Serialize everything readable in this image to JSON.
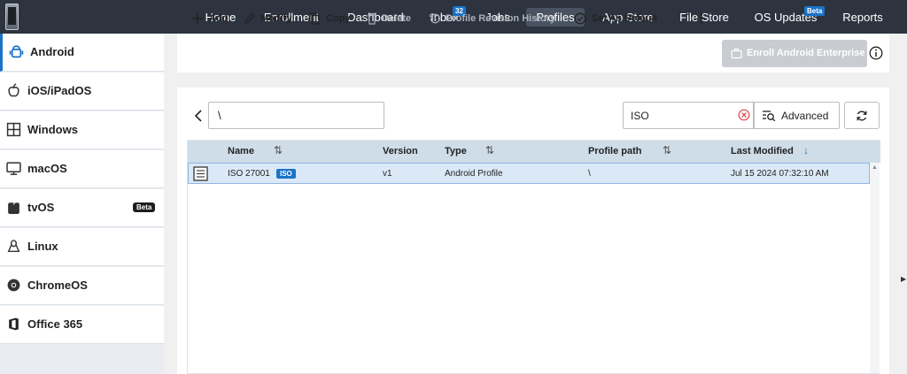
{
  "nav": {
    "items": [
      {
        "label": "Home"
      },
      {
        "label": "Enrollment"
      },
      {
        "label": "Dashboard"
      },
      {
        "label": "Inbox",
        "badge": "32"
      },
      {
        "label": "Jobs"
      },
      {
        "label": "Profiles",
        "active": true
      },
      {
        "label": "App Store"
      },
      {
        "label": "File Store"
      },
      {
        "label": "OS Updates",
        "badge": "Beta"
      },
      {
        "label": "Reports"
      }
    ]
  },
  "sidebar": {
    "items": [
      {
        "label": "Android",
        "icon": "android-icon",
        "active": true
      },
      {
        "label": "iOS/iPadOS",
        "icon": "apple-icon"
      },
      {
        "label": "Windows",
        "icon": "windows-icon"
      },
      {
        "label": "macOS",
        "icon": "monitor-icon"
      },
      {
        "label": "tvOS",
        "icon": "tv-icon",
        "badge": "Beta"
      },
      {
        "label": "Linux",
        "icon": "linux-icon"
      },
      {
        "label": "ChromeOS",
        "icon": "chrome-icon"
      },
      {
        "label": "Office 365",
        "icon": "office-icon"
      }
    ]
  },
  "toolbar": {
    "add": "Add",
    "modify": "Modify",
    "copy": "Copy",
    "delete": "Delete",
    "history": "Profile Revision History",
    "set_default": "Set As Default",
    "enroll": "Enroll Android Enterprise"
  },
  "filters": {
    "path_value": "\\",
    "search_value": "ISO",
    "advanced_label": "Advanced"
  },
  "table": {
    "columns": [
      "Name",
      "Version",
      "Type",
      "Profile path",
      "Last Modified"
    ],
    "rows": [
      {
        "name": "ISO 27001",
        "tag": "ISO",
        "version": "v1",
        "type": "Android Profile",
        "path": "\\",
        "modified": "Jul 15 2024 07:32:10 AM"
      }
    ]
  },
  "colors": {
    "nav_bg": "#2d3440",
    "accent": "#1a73c8",
    "selected_row": "#dbe9f7",
    "header_bg": "#cfdde9"
  }
}
